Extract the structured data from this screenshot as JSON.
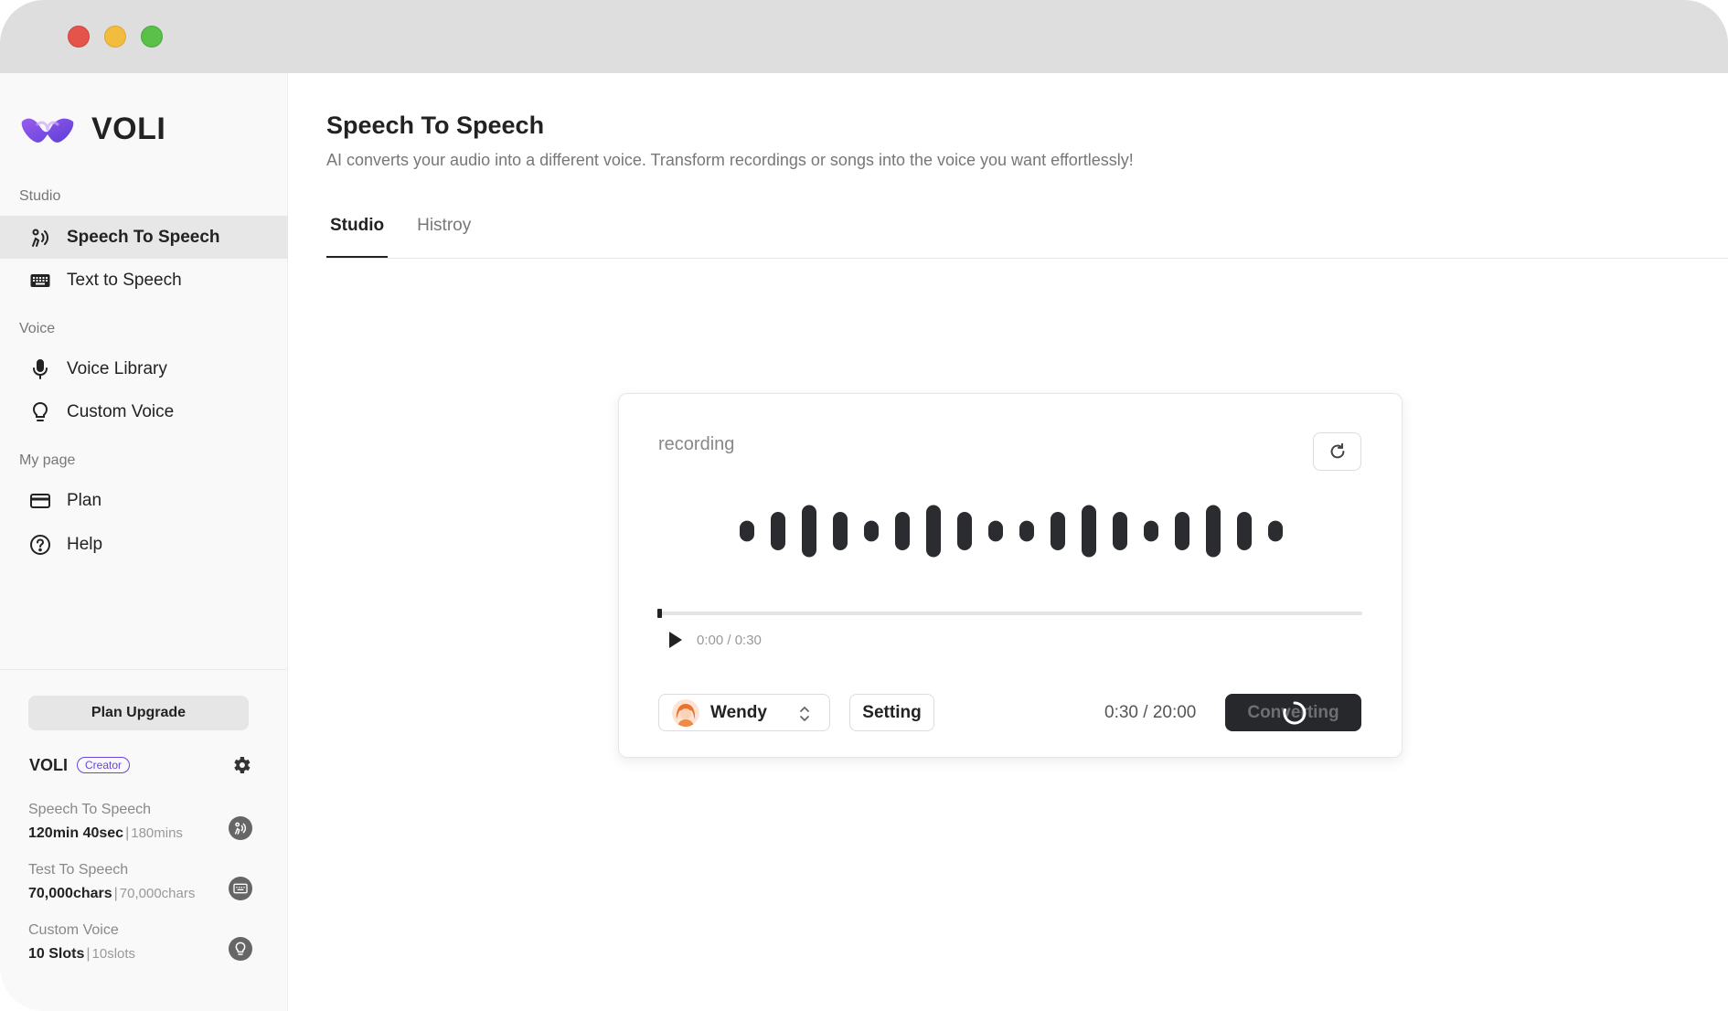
{
  "app": {
    "name": "VOLI"
  },
  "sidebar": {
    "sections": [
      {
        "label": "Studio"
      },
      {
        "label": "Voice"
      },
      {
        "label": "My page"
      }
    ],
    "items": [
      {
        "label": "Speech To Speech",
        "icon": "speech-to-speech-icon",
        "active": true
      },
      {
        "label": "Text to Speech",
        "icon": "keyboard-icon",
        "active": false
      },
      {
        "label": "Voice Library",
        "icon": "microphone-icon",
        "active": false
      },
      {
        "label": "Custom Voice",
        "icon": "lightbulb-icon",
        "active": false
      },
      {
        "label": "Plan",
        "icon": "credit-card-icon",
        "active": false
      },
      {
        "label": "Help",
        "icon": "help-circle-icon",
        "active": false
      }
    ],
    "upgrade_label": "Plan Upgrade",
    "account": {
      "name": "VOLI",
      "plan_badge": "Creator"
    },
    "usage": [
      {
        "label": "Speech To Speech",
        "used": "120min 40sec",
        "total": "180mins",
        "icon": "speech-to-speech-icon"
      },
      {
        "label": "Test To Speech",
        "used": "70,000chars",
        "total": "70,000chars",
        "icon": "keyboard-icon"
      },
      {
        "label": "Custom Voice",
        "used": "10 Slots",
        "total": "10slots",
        "icon": "lightbulb-icon"
      }
    ]
  },
  "main": {
    "title": "Speech To Speech",
    "subtitle": "AI converts your audio into a different voice. Transform recordings or songs into the voice you want effortlessly!",
    "tabs": [
      {
        "label": "Studio",
        "active": true
      },
      {
        "label": "Histroy",
        "active": false
      }
    ]
  },
  "card": {
    "label": "recording",
    "player_time": "0:00 / 0:30",
    "progress": 0.0,
    "voice": "Wendy",
    "setting_label": "Setting",
    "duration": "0:30 / 20:00",
    "convert_label": "Converting",
    "waveform_levels": [
      0.38,
      0.7,
      0.95,
      0.7,
      0.38,
      0.7,
      0.95,
      0.7,
      0.38,
      0.38,
      0.7,
      0.95,
      0.7,
      0.38,
      0.7,
      0.95,
      0.7,
      0.38
    ]
  },
  "colors": {
    "accent_purple": "#6a45d8",
    "dark_button": "#26282c",
    "sidebar_bg": "#f9f9f9",
    "active_item_bg": "#e7e7e7"
  }
}
